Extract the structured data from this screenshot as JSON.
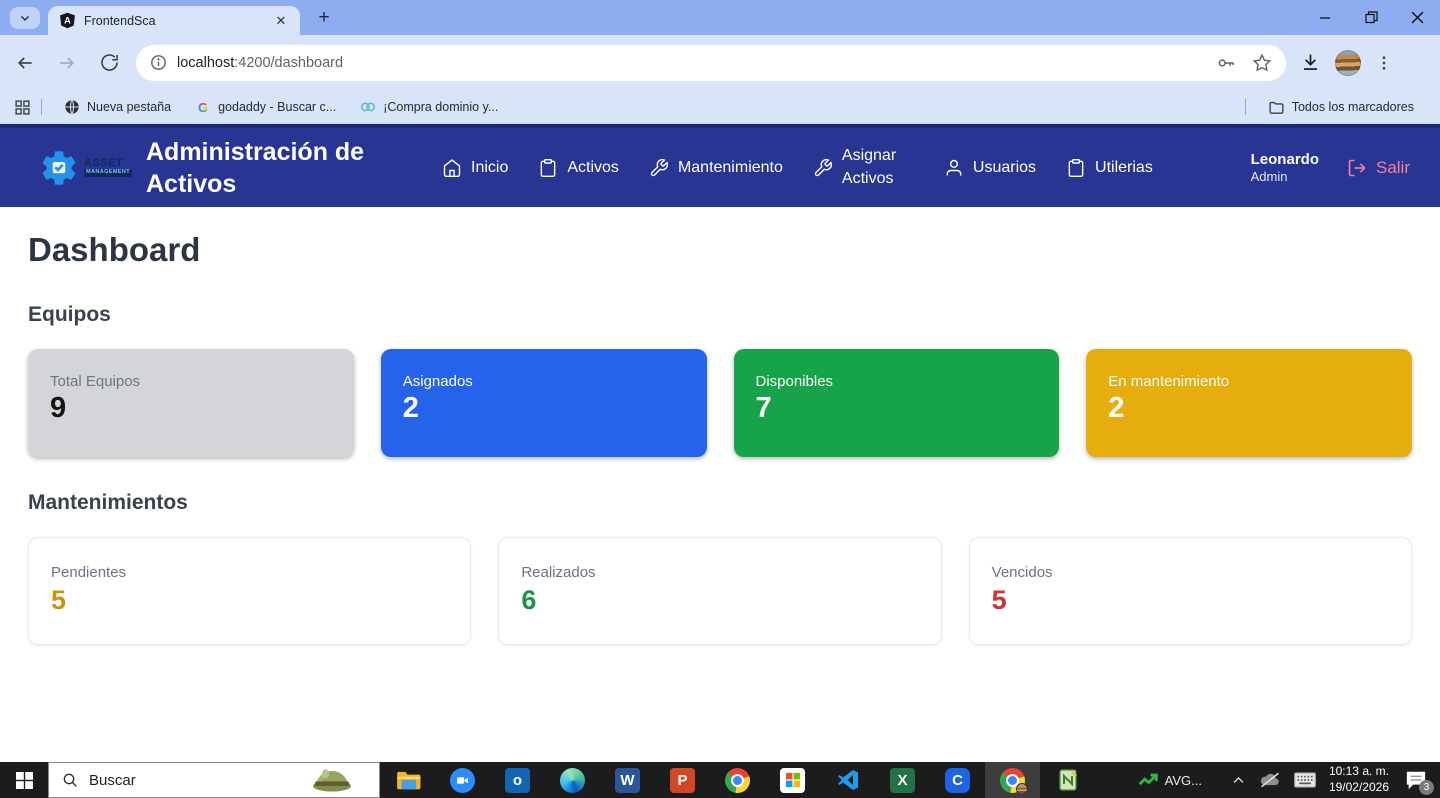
{
  "browser": {
    "tab_title": "FrontendSca",
    "url_host": "localhost",
    "url_path": ":4200/dashboard",
    "bookmarks": {
      "new_tab": "Nueva pestaña",
      "godaddy": "godaddy - Buscar c...",
      "compra": "¡Compra dominio y...",
      "all_bookmarks": "Todos los marcadores"
    }
  },
  "navbar": {
    "bg_color": "#283593",
    "brand_line1": "ASSET",
    "brand_line2": "MANAGEMENT",
    "app_title": "Administración de Activos",
    "items": [
      {
        "label": "Inicio",
        "icon": "home-icon"
      },
      {
        "label": "Activos",
        "icon": "clipboard-icon"
      },
      {
        "label": "Mantenimiento",
        "icon": "wrench-icon"
      },
      {
        "label": "Asignar Activos",
        "icon": "wrench-icon"
      },
      {
        "label": "Usuarios",
        "icon": "user-icon"
      },
      {
        "label": "Utilerias",
        "icon": "clipboard-icon"
      }
    ],
    "user_name": "Leonardo",
    "user_role": "Admin",
    "logout_label": "Salir",
    "logout_color": "#f2839a"
  },
  "dashboard": {
    "title": "Dashboard",
    "sections": [
      {
        "heading": "Equipos",
        "cards": [
          {
            "label": "Total Equipos",
            "value": "9",
            "bg": "#d3d5d8",
            "text_color": "#151515"
          },
          {
            "label": "Asignados",
            "value": "2",
            "bg": "#2563eb",
            "text_color": "#ffffff"
          },
          {
            "label": "Disponibles",
            "value": "7",
            "bg": "#17a34a",
            "text_color": "#ffffff"
          },
          {
            "label": "En mantenimiento",
            "value": "2",
            "bg": "#e6ad0e",
            "text_color": "#ffffff"
          }
        ]
      },
      {
        "heading": "Mantenimientos",
        "cards": [
          {
            "label": "Pendientes",
            "value": "5",
            "value_color": "#c9940d"
          },
          {
            "label": "Realizados",
            "value": "6",
            "value_color": "#199648"
          },
          {
            "label": "Vencidos",
            "value": "5",
            "value_color": "#d3302f"
          }
        ]
      }
    ]
  },
  "taskbar": {
    "search_text": "Buscar",
    "avg_label": "AVG...",
    "time": "10:13 a. m.",
    "date": "19/02/2026",
    "notification_count": "3"
  }
}
